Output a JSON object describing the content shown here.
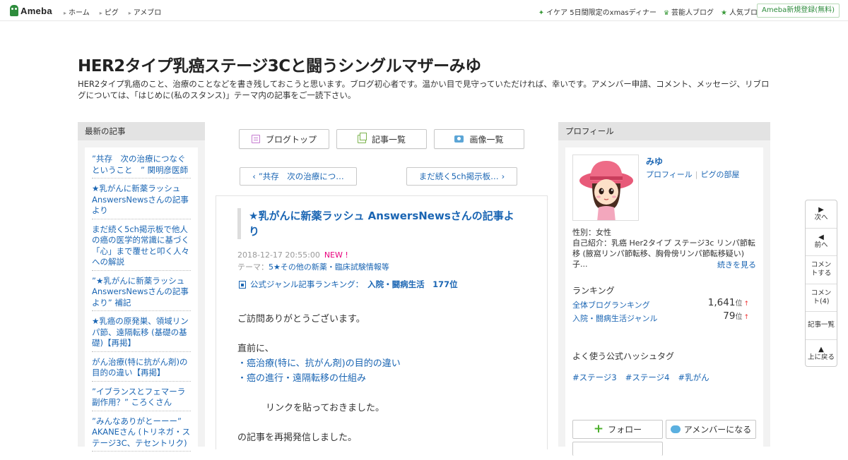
{
  "header": {
    "logo_text": "Ameba",
    "nav": [
      "ホーム",
      "ピグ",
      "アメブロ"
    ],
    "right_links": [
      "イケア 5日間限定のxmasディナー",
      "芸能人ブログ",
      "人気ブログ"
    ],
    "signup": "Ameba新規登録(無料)"
  },
  "blog": {
    "title": "HER2タイプ乳癌ステージ3Cと闘うシングルマザーみゆ",
    "description": "HER2タイプ乳癌のこと、治療のことなどを書き残しておこうと思います。ブログ初心者です。温かい目で見守っていただければ、幸いです。アメンバー申請、コメント、メッセージ、リブログについては、「はじめに(私のスタンス)」テーマ内の記事をご一読下さい。"
  },
  "sidebar_left": {
    "heading": "最新の記事",
    "items": [
      "”共存　次の治療につなぐということ　” 関明彦医師",
      "★乳がんに新薬ラッシュ AnswersNewsさんの記事より",
      "まだ続く5ch掲示板で他人の癌の医学的常識に基づく「心」まで覆せと叩く人々への解説",
      "”★乳がんに新薬ラッシュ AnswersNewsさんの記事より” 補記",
      "★乳癌の原発巣、領域リンパ節、遠隔転移 (基礎の基礎)【再掲】",
      "がん治療(特に抗がん剤)の目的の違い【再掲】",
      "”イブランスとフェマーラ副作用？” ころくさん",
      "”みんなありがとーーー” AKANEさん (トリネガ・ステージ3C、テセントリク)"
    ]
  },
  "toolbar": {
    "blog_top": "ブログトップ",
    "article_list": "記事一覧",
    "image_list": "画像一覧"
  },
  "pager": {
    "prev": "”共存　次の治療につ…",
    "next": "まだ続く5ch掲示板…"
  },
  "article": {
    "title": "★乳がんに新薬ラッシュ AnswersNewsさんの記事より",
    "date": "2018-12-17 20:55:00",
    "new_badge": "NEW !",
    "theme_label": "テーマ：",
    "theme": "5★その他の新薬・臨床試験情報等",
    "rank_label": "公式ジャンル記事ランキング：",
    "rank_value": "入院・闘病生活　177位",
    "body": {
      "greeting": "ご訪問ありがとうございます。",
      "intro": "直前に、",
      "link1": "・癌治療(特に、抗がん剤)の目的の違い",
      "link2": "・癌の進行・遠隔転移の仕組み",
      "linked_note": "リンクを貼っておきました。",
      "repost": "の記事を再掲発信しました。"
    }
  },
  "profile": {
    "heading": "プロフィール",
    "name": "みゆ",
    "link_profile": "プロフィール",
    "link_pigg": "ピグの部屋",
    "gender": "性別：女性",
    "intro": "自己紹介：乳癌 Her2タイプ ステージ3c リンパ節転移 (腋窩リンパ節転移、胸骨傍リンパ節転移疑い) 子...",
    "more": "続きを見る",
    "ranking_heading": "ランキング",
    "ranking": [
      {
        "label": "全体ブログランキング",
        "value": "1,641",
        "unit": "位",
        "trend": "↑"
      },
      {
        "label": "入院・闘病生活ジャンル",
        "value": "79",
        "unit": "位",
        "trend": "↑"
      }
    ],
    "hashtag_heading": "よく使う公式ハッシュタグ",
    "hashtags": [
      "#ステージ3",
      "#ステージ4",
      "#乳がん"
    ],
    "follow": "フォロー",
    "amember": "アメンバーになる"
  },
  "float_nav": {
    "next": "次へ",
    "prev": "前へ",
    "comment": "コメントする",
    "comment_count": "コメント(4)",
    "article_list": "記事一覧",
    "top": "上に戻る"
  },
  "colors": {
    "link": "#1a65b3",
    "brand_green": "#2d8c3c",
    "new_badge": "#e8007d",
    "sidebar_bg": "#f2f2f2"
  }
}
